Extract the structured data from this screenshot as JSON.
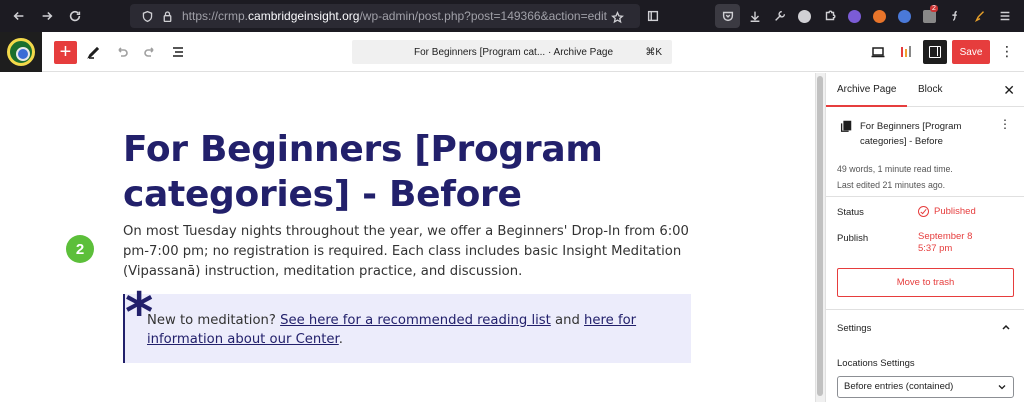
{
  "browser": {
    "url_prefix": "https://crmp.",
    "url_domain": "cambridgeinsight.org",
    "url_path": "/wp-admin/post.php?post=149366&action=edit",
    "extension_badge": "2"
  },
  "toolbar": {
    "add_label": "+",
    "doc_title": "For Beginners [Program cat...",
    "doc_type": "· Archive Page",
    "shortcut": "⌘K",
    "save_label": "Save",
    "more_label": "⋮"
  },
  "content": {
    "title": "For Beginners [Program categories] - Before",
    "step_number": "2",
    "intro": "On most Tuesday nights throughout the year, we offer a Beginners' Drop-In from 6:00 pm-7:00 pm; no registration is required. Each class includes basic Insight Meditation (Vipassanā) instruction, meditation practice, and discussion.",
    "callout": {
      "asterisk": "*",
      "prefix": "New to meditation? ",
      "link1": "See here for a recommended reading list",
      "middle": " and ",
      "link2": "here for information about our Center",
      "suffix": "."
    }
  },
  "sidebar": {
    "tabs": [
      "Archive Page",
      "Block"
    ],
    "close_label": "✕",
    "doc_name": "For Beginners [Program categories] - Before",
    "more_label": "⋮",
    "word_count": "49 words, 1 minute read time.",
    "last_edited": "Last edited 21 minutes ago.",
    "status_label": "Status",
    "status_value": "Published",
    "publish_label": "Publish",
    "publish_value": "September 8 5:37 pm",
    "trash_label": "Move to trash",
    "settings_label": "Settings",
    "locations_label": "Locations Settings",
    "locations_value": "Before entries (contained)"
  },
  "colors": {
    "accent": "#e63d3d",
    "title": "#22206b",
    "callout_bg": "#ececfb",
    "step_badge": "#5cbf3a"
  }
}
